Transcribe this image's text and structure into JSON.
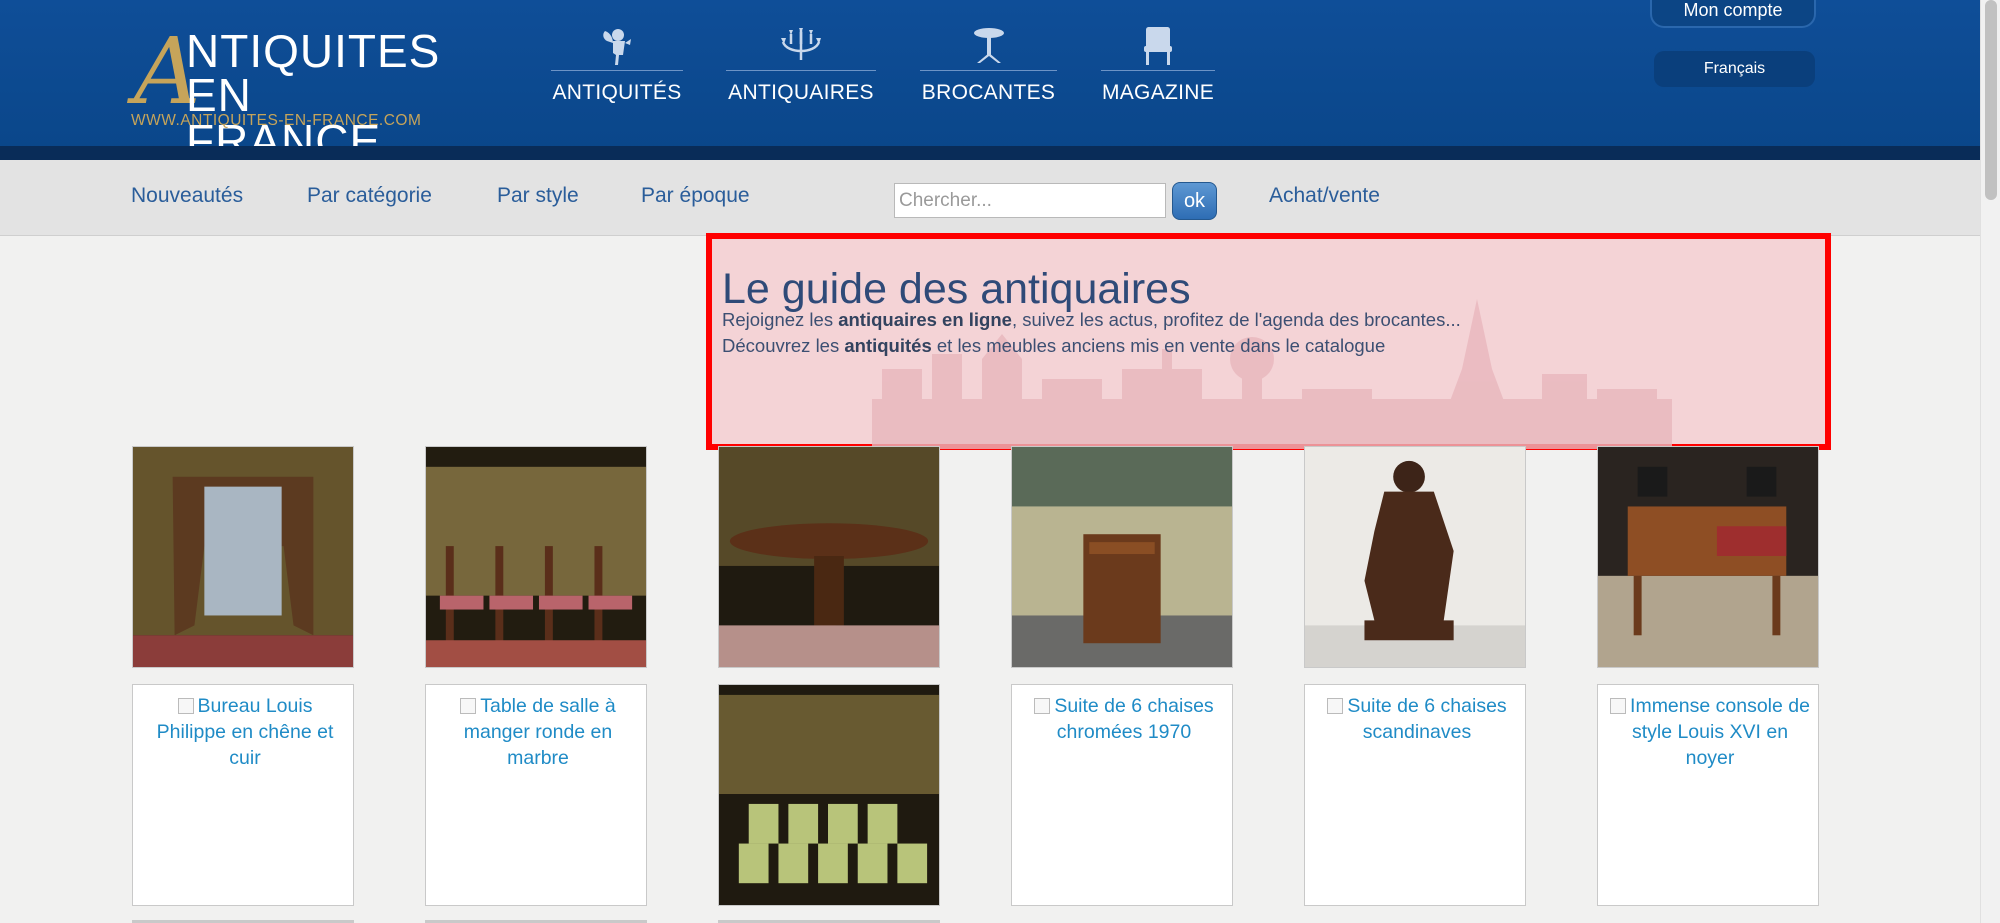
{
  "header": {
    "logo": {
      "line1": "NTIQUITES",
      "line2": "EN FRANCE",
      "letter": "A",
      "url": "WWW.ANTIQUITES-EN-FRANCE.COM"
    },
    "nav": [
      {
        "label": "ANTIQUITÉS",
        "icon": "cherub-icon"
      },
      {
        "label": "ANTIQUAIRES",
        "icon": "chandelier-icon"
      },
      {
        "label": "BROCANTES",
        "icon": "pedestal-table-icon"
      },
      {
        "label": "MAGAZINE",
        "icon": "armchair-icon"
      }
    ],
    "account": "Mon compte",
    "language": "Français"
  },
  "subnav": {
    "links": [
      "Nouveautés",
      "Par catégorie",
      "Par style",
      "Par époque"
    ],
    "search_placeholder": "Chercher...",
    "search_button": "ok",
    "buy_sell": "Achat/vente"
  },
  "hero": {
    "title": "Le guide des antiquaires",
    "line1_pre": "Rejoignez les ",
    "line1_bold": "antiquaires en ligne",
    "line1_post": ", suivez les actus, profitez de l'agenda des brocantes...",
    "line2_pre": "Découvrez les ",
    "line2_bold": "antiquités",
    "line2_post": " et les meubles anciens mis en vente dans le catalogue"
  },
  "products_row2": [
    {
      "alt": "Bureau Louis Philippe en chêne et cuir"
    },
    {
      "alt": "Table de salle à manger ronde en marbre"
    },
    {
      "alt": ""
    },
    {
      "alt": "Suite de 6 chaises chromées 1970"
    },
    {
      "alt": "Suite de 6 chaises scandinaves"
    },
    {
      "alt": "Immense console de style Louis XVI en noyer"
    }
  ],
  "colors": {
    "header_blue": "#0f4e98",
    "gold": "#c6a45a",
    "link_blue": "#2a5d9a",
    "alt_link": "#1f8bc6",
    "highlight_border": "#ff0000"
  }
}
